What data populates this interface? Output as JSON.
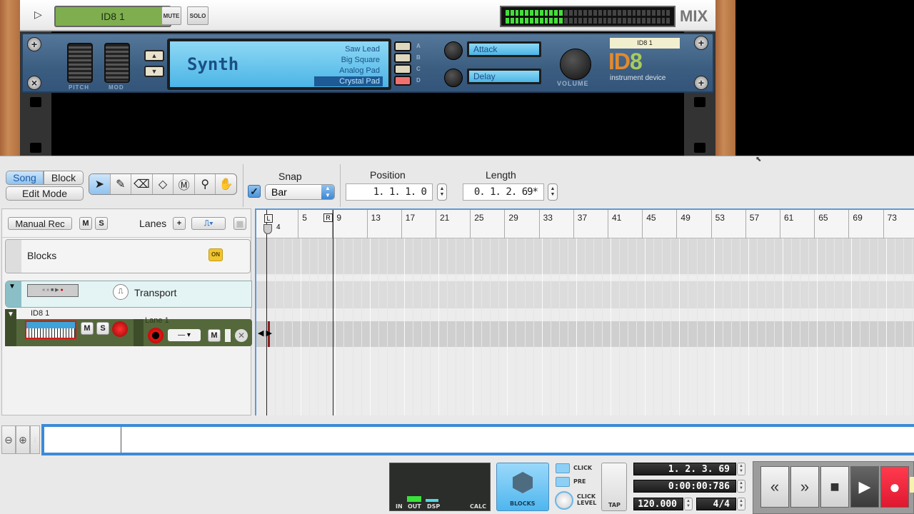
{
  "rack": {
    "track_name": "ID8 1",
    "mute_label": "MUTE",
    "solo_label": "SOLO",
    "mix_label": "MIX",
    "vu_level": 0.33,
    "device": {
      "pitch_label": "PITCH",
      "mod_label": "MOD",
      "display_title": "Synth",
      "patches": [
        {
          "label": "Saw Lead",
          "key": "A",
          "selected": false
        },
        {
          "label": "Big Square",
          "key": "B",
          "selected": false
        },
        {
          "label": "Analog Pad",
          "key": "C",
          "selected": false
        },
        {
          "label": "Crystal Pad",
          "key": "D",
          "selected": true
        }
      ],
      "param1": "Attack",
      "param2": "Delay",
      "volume_label": "VOLUME",
      "name_tag": "ID8 1",
      "logo_id": "ID",
      "logo_8": "8",
      "subtitle": "instrument device"
    }
  },
  "toolbar": {
    "song_label": "Song",
    "block_label": "Block",
    "edit_mode_label": "Edit Mode",
    "tools": [
      "select-arrow",
      "pencil",
      "eraser",
      "razor",
      "mute-tool",
      "magnify",
      "hand"
    ],
    "snap_label": "Snap",
    "snap_checked": true,
    "snap_value": "Bar",
    "position_label": "Position",
    "position_value": "1.  1.  1.    0",
    "length_label": "Length",
    "length_value": "0.  1.  2.  69*"
  },
  "tracklist": {
    "manual_rec_label": "Manual Rec",
    "m_label": "M",
    "s_label": "S",
    "lanes_label": "Lanes",
    "add_label": "+",
    "blocks_label": "Blocks",
    "blocks_on": "ON",
    "transport_label": "Transport",
    "instrument_track_name": "ID8 1",
    "lane_label": "Lane 1",
    "lane_select": "—"
  },
  "ruler": {
    "bars": [
      "5",
      "9",
      "13",
      "17",
      "21",
      "25",
      "29",
      "33",
      "37",
      "41",
      "45",
      "49",
      "53",
      "57",
      "61",
      "65",
      "69",
      "73"
    ],
    "left_locator": "L",
    "right_locator": "R",
    "playhead_label": "4"
  },
  "transport": {
    "in_label": "IN",
    "out_label": "OUT",
    "dsp_label": "DSP",
    "calc_label": "CALC",
    "blocks_label": "BLOCKS",
    "click_label": "CLICK",
    "pre_label": "PRE",
    "click_level_label": "CLICK\nLEVEL",
    "tap_label": "TAP",
    "bars_position": "1. 2. 3. 69",
    "time_position": "0:00:00:786",
    "tempo": "120.000",
    "signature": "4/4"
  }
}
